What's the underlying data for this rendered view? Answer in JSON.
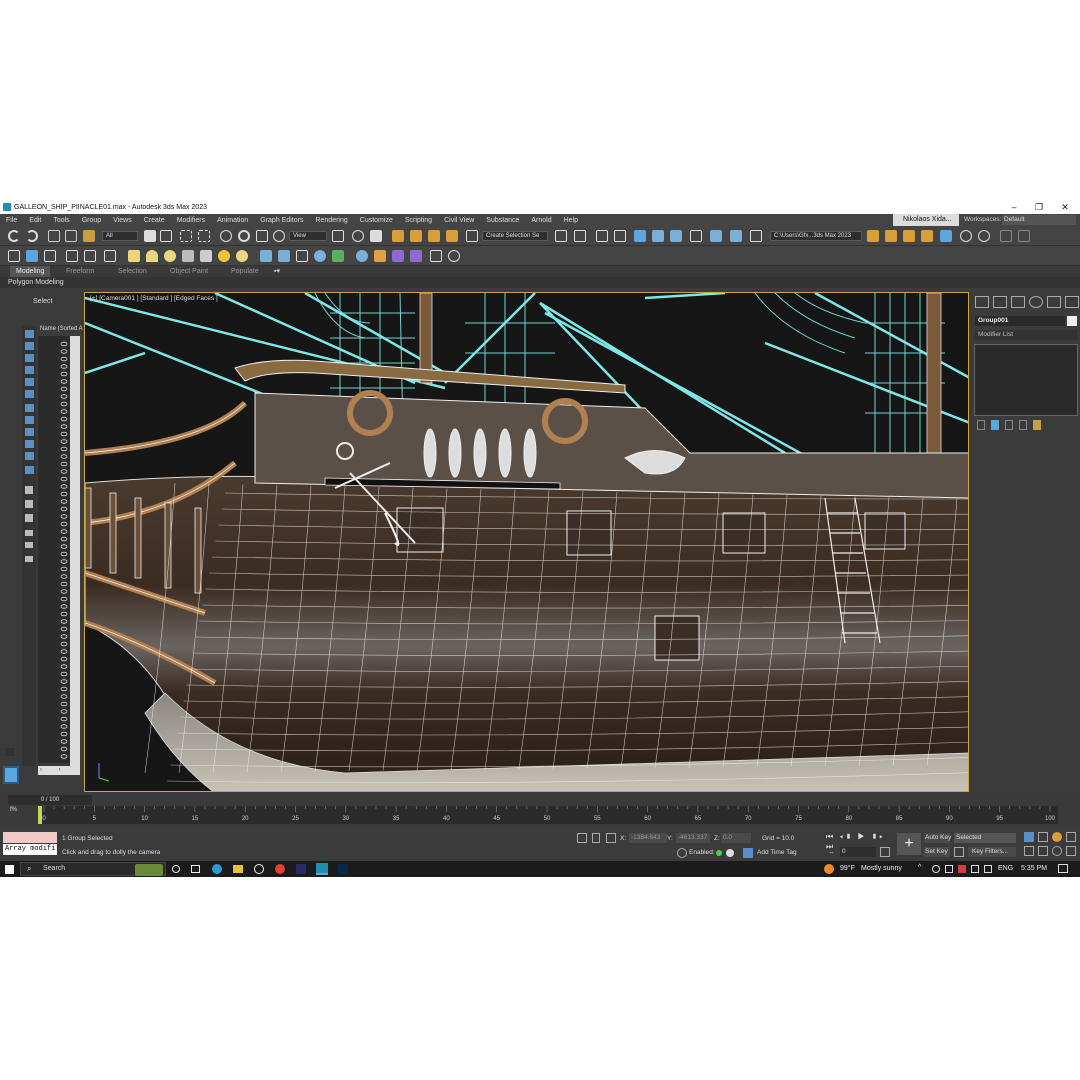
{
  "window": {
    "title": "GALLEON_SHIP_PIINACLE01.max - Autodesk 3ds Max 2023",
    "controls": [
      "–",
      "❐",
      "✕"
    ]
  },
  "menu": [
    "File",
    "Edit",
    "Tools",
    "Group",
    "Views",
    "Create",
    "Modifiers",
    "Animation",
    "Graph Editors",
    "Rendering",
    "Customize",
    "Scripting",
    "Civil View",
    "Substance",
    "Arnold",
    "Help"
  ],
  "user": "Nikolaos Xida...",
  "workspaces": {
    "label": "Workspaces:",
    "value": "Default"
  },
  "toolbar": {
    "selection_filter": "All",
    "reference_coord": "View",
    "named_selection": "Create Selection Se",
    "project_path": "C:\\Users\\Gfx...3ds Max 2023"
  },
  "ribbon": {
    "tabs": [
      "Modeling",
      "Freeform",
      "Selection",
      "Object Paint",
      "Populate"
    ],
    "active": "Modeling",
    "sub": "Polygon Modeling"
  },
  "scene_explorer": {
    "select_label": "Select",
    "name_column": "Name (Sorted A"
  },
  "viewport": {
    "label": "[+] [Camera001 ] [Standard ] [Edged Faces ]"
  },
  "command_panel": {
    "object_name": "Group001",
    "modifier_list": "Modifier List"
  },
  "timeline": {
    "frame_counter": "0 / 100",
    "ticks": [
      "0",
      "5",
      "10",
      "15",
      "20",
      "25",
      "30",
      "35",
      "40",
      "45",
      "50",
      "55",
      "60",
      "65",
      "70",
      "75",
      "80",
      "85",
      "90",
      "95",
      "100"
    ]
  },
  "status": {
    "maxscript": "Array modifi",
    "selection": "1 Group Selected",
    "prompt": "Click and drag to dolly the camera",
    "x_label": "X:",
    "x_value": "-1384.643",
    "y_label": "Y:",
    "y_value": "-4613.337",
    "z_label": "Z:",
    "z_value": "0.0",
    "grid": "Grid = 10.0",
    "enabled_label": "Enabled:",
    "add_time_tag": "Add Time Tag",
    "auto_key": "Auto Key",
    "set_key": "Set Key",
    "selected": "Selected",
    "key_filters": "Key Filters...",
    "frame_field": "0"
  },
  "taskbar": {
    "search": "Search",
    "weather_temp": "99°F",
    "weather_text": "Mostly sunny",
    "language": "ENG",
    "time": "5:35 PM"
  },
  "colors": {
    "ui_bg": "#3b3b3b",
    "wire_cyan": "#7ee7e7",
    "active_blue": "#5aa7e0",
    "viewport_border": "#c6a84a"
  }
}
